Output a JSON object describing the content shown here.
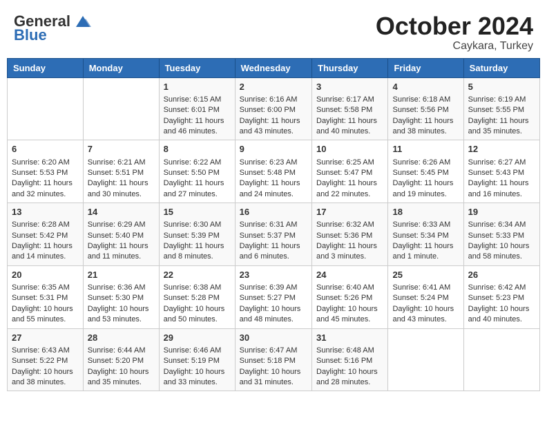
{
  "header": {
    "logo_general": "General",
    "logo_blue": "Blue",
    "month": "October 2024",
    "location": "Caykara, Turkey"
  },
  "weekdays": [
    "Sunday",
    "Monday",
    "Tuesday",
    "Wednesday",
    "Thursday",
    "Friday",
    "Saturday"
  ],
  "weeks": [
    [
      {
        "day": "",
        "content": ""
      },
      {
        "day": "",
        "content": ""
      },
      {
        "day": "1",
        "content": "Sunrise: 6:15 AM\nSunset: 6:01 PM\nDaylight: 11 hours and 46 minutes."
      },
      {
        "day": "2",
        "content": "Sunrise: 6:16 AM\nSunset: 6:00 PM\nDaylight: 11 hours and 43 minutes."
      },
      {
        "day": "3",
        "content": "Sunrise: 6:17 AM\nSunset: 5:58 PM\nDaylight: 11 hours and 40 minutes."
      },
      {
        "day": "4",
        "content": "Sunrise: 6:18 AM\nSunset: 5:56 PM\nDaylight: 11 hours and 38 minutes."
      },
      {
        "day": "5",
        "content": "Sunrise: 6:19 AM\nSunset: 5:55 PM\nDaylight: 11 hours and 35 minutes."
      }
    ],
    [
      {
        "day": "6",
        "content": "Sunrise: 6:20 AM\nSunset: 5:53 PM\nDaylight: 11 hours and 32 minutes."
      },
      {
        "day": "7",
        "content": "Sunrise: 6:21 AM\nSunset: 5:51 PM\nDaylight: 11 hours and 30 minutes."
      },
      {
        "day": "8",
        "content": "Sunrise: 6:22 AM\nSunset: 5:50 PM\nDaylight: 11 hours and 27 minutes."
      },
      {
        "day": "9",
        "content": "Sunrise: 6:23 AM\nSunset: 5:48 PM\nDaylight: 11 hours and 24 minutes."
      },
      {
        "day": "10",
        "content": "Sunrise: 6:25 AM\nSunset: 5:47 PM\nDaylight: 11 hours and 22 minutes."
      },
      {
        "day": "11",
        "content": "Sunrise: 6:26 AM\nSunset: 5:45 PM\nDaylight: 11 hours and 19 minutes."
      },
      {
        "day": "12",
        "content": "Sunrise: 6:27 AM\nSunset: 5:43 PM\nDaylight: 11 hours and 16 minutes."
      }
    ],
    [
      {
        "day": "13",
        "content": "Sunrise: 6:28 AM\nSunset: 5:42 PM\nDaylight: 11 hours and 14 minutes."
      },
      {
        "day": "14",
        "content": "Sunrise: 6:29 AM\nSunset: 5:40 PM\nDaylight: 11 hours and 11 minutes."
      },
      {
        "day": "15",
        "content": "Sunrise: 6:30 AM\nSunset: 5:39 PM\nDaylight: 11 hours and 8 minutes."
      },
      {
        "day": "16",
        "content": "Sunrise: 6:31 AM\nSunset: 5:37 PM\nDaylight: 11 hours and 6 minutes."
      },
      {
        "day": "17",
        "content": "Sunrise: 6:32 AM\nSunset: 5:36 PM\nDaylight: 11 hours and 3 minutes."
      },
      {
        "day": "18",
        "content": "Sunrise: 6:33 AM\nSunset: 5:34 PM\nDaylight: 11 hours and 1 minute."
      },
      {
        "day": "19",
        "content": "Sunrise: 6:34 AM\nSunset: 5:33 PM\nDaylight: 10 hours and 58 minutes."
      }
    ],
    [
      {
        "day": "20",
        "content": "Sunrise: 6:35 AM\nSunset: 5:31 PM\nDaylight: 10 hours and 55 minutes."
      },
      {
        "day": "21",
        "content": "Sunrise: 6:36 AM\nSunset: 5:30 PM\nDaylight: 10 hours and 53 minutes."
      },
      {
        "day": "22",
        "content": "Sunrise: 6:38 AM\nSunset: 5:28 PM\nDaylight: 10 hours and 50 minutes."
      },
      {
        "day": "23",
        "content": "Sunrise: 6:39 AM\nSunset: 5:27 PM\nDaylight: 10 hours and 48 minutes."
      },
      {
        "day": "24",
        "content": "Sunrise: 6:40 AM\nSunset: 5:26 PM\nDaylight: 10 hours and 45 minutes."
      },
      {
        "day": "25",
        "content": "Sunrise: 6:41 AM\nSunset: 5:24 PM\nDaylight: 10 hours and 43 minutes."
      },
      {
        "day": "26",
        "content": "Sunrise: 6:42 AM\nSunset: 5:23 PM\nDaylight: 10 hours and 40 minutes."
      }
    ],
    [
      {
        "day": "27",
        "content": "Sunrise: 6:43 AM\nSunset: 5:22 PM\nDaylight: 10 hours and 38 minutes."
      },
      {
        "day": "28",
        "content": "Sunrise: 6:44 AM\nSunset: 5:20 PM\nDaylight: 10 hours and 35 minutes."
      },
      {
        "day": "29",
        "content": "Sunrise: 6:46 AM\nSunset: 5:19 PM\nDaylight: 10 hours and 33 minutes."
      },
      {
        "day": "30",
        "content": "Sunrise: 6:47 AM\nSunset: 5:18 PM\nDaylight: 10 hours and 31 minutes."
      },
      {
        "day": "31",
        "content": "Sunrise: 6:48 AM\nSunset: 5:16 PM\nDaylight: 10 hours and 28 minutes."
      },
      {
        "day": "",
        "content": ""
      },
      {
        "day": "",
        "content": ""
      }
    ]
  ]
}
